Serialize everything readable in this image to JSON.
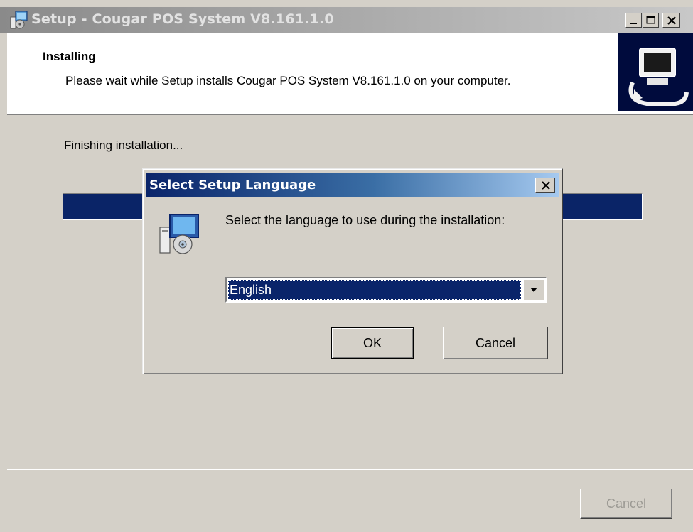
{
  "window": {
    "title": "Setup - Cougar POS System V8.161.1.0",
    "controls": [
      "minimize",
      "maximize",
      "close"
    ]
  },
  "header": {
    "title": "Installing",
    "subtitle": "Please wait while Setup installs Cougar POS System V8.161.1.0 on your computer."
  },
  "main": {
    "status": "Finishing installation...",
    "progress": 1.0
  },
  "footer": {
    "cancel_label": "Cancel",
    "cancel_enabled": false
  },
  "dialog": {
    "title": "Select Setup Language",
    "prompt": "Select the language to use during the installation:",
    "language": {
      "selected": "English"
    },
    "ok_label": "OK",
    "cancel_label": "Cancel"
  },
  "colors": {
    "progress_fill": "#0a2467",
    "dialog_title_start": "#0a246a",
    "dialog_title_end": "#a6caf0",
    "face": "#d4d0c8"
  }
}
